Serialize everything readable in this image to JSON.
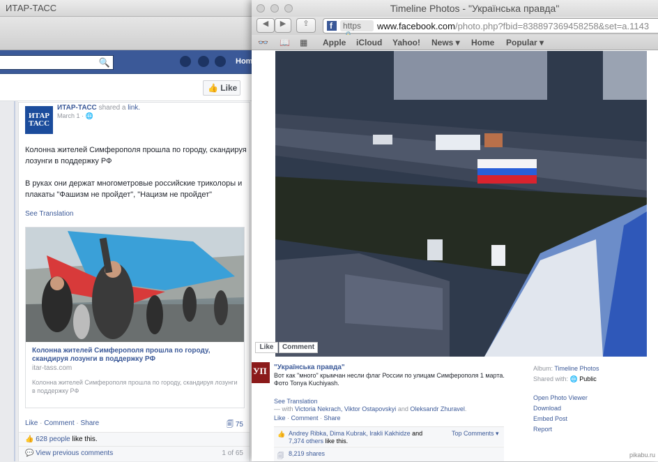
{
  "back_window": {
    "title": "ИТАР-ТАСС",
    "fb_home": "Home",
    "like_page_label": "Like",
    "post": {
      "avatar_text": "ИТАР ТАСС",
      "author": "ИТАР-ТАСС",
      "shared_text": "shared a",
      "shared_link": "link.",
      "date": "March 1",
      "text_1": "Колонна жителей Симферополя прошла по городу, скандируя лозунги в поддержку РФ",
      "text_2": "В руках они держат многометровые российские триколоры и плакаты \"Фашизм не пройдет\", \"Нацизм не пройдет\"",
      "see_translation": "See Translation",
      "card_title": "Колонна жителей Симферополя прошла по городу, скандируя лозунги в поддержку РФ",
      "card_domain": "itar-tass.com",
      "card_desc": "Колонна жителей Симферополя прошла по городу, скандируя лозунги в поддержку РФ",
      "action_like": "Like",
      "action_comment": "Comment",
      "action_share": "Share",
      "share_count": "75",
      "likes_count_link": "628 people",
      "likes_suffix": "like this.",
      "view_previous": "View previous comments",
      "comments_count": "1 of 65"
    }
  },
  "front_window": {
    "title": "Timeline Photos - \"Українська правда\"",
    "https_label": "https",
    "url_host": "www.facebook.com",
    "url_path": "/photo.php?fbid=838897369458258&set=a.1143",
    "bookmarks": [
      "Apple",
      "iCloud",
      "Yahoo!",
      "News ▾",
      "Home",
      "Popular ▾"
    ],
    "photo_like": "Like",
    "photo_comment": "Comment",
    "avatar_text": "УП",
    "author": "\"Українська правда\"",
    "caption_1": "Вот как \"много\" крымчан несли флаг России по улицам Симферополя 1 марта.",
    "caption_2": "Фото Tonya Kuchiyash.",
    "see_translation": "See Translation",
    "with_prefix": "— with",
    "tagged_1": "Victoria Nekrach,",
    "tagged_2": "Viktor Ostapovskyi",
    "with_and": "and",
    "tagged_3": "Oleksandr Zhuravel",
    "action_like": "Like",
    "action_comment": "Comment",
    "action_share": "Share",
    "likers_1": "Andrey Ribka,",
    "likers_2": "Dima Kubrak,",
    "likers_3": "Irakli Kakhidze",
    "likers_and": "and",
    "likers_others": "7,374 others",
    "likers_suffix": "like this.",
    "top_comments": "Top Comments ▾",
    "shares": "8,219 shares",
    "album_label": "Album:",
    "album_value": "Timeline Photos",
    "shared_with_label": "Shared with:",
    "shared_with_value": "Public",
    "open_viewer": "Open Photo Viewer",
    "download": "Download",
    "embed": "Embed Post",
    "report": "Report"
  },
  "watermark": "pikabu.ru"
}
